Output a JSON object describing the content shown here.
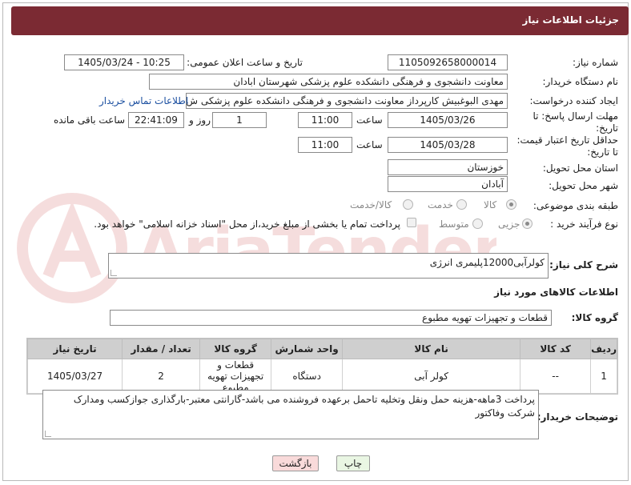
{
  "header": {
    "title": "جزئیات اطلاعات نیاز"
  },
  "form": {
    "need_number_label": "شماره نیاز:",
    "need_number": "1105092658000014",
    "announce_label": "تاریخ و ساعت اعلان عمومی:",
    "announce_value": "1405/03/24 - 10:25",
    "buyer_org_label": "نام دستگاه خریدار:",
    "buyer_org": "معاونت دانشجوی و فرهنگی دانشکده علوم پزشکی شهرستان ابادان",
    "requester_label": "ایجاد کننده درخواست:",
    "requester": "مهدی البوغبیش کارپرداز معاونت دانشجوی و فرهنگی دانشکده علوم پزشکی ش",
    "contact_link": "اطلاعات تماس خریدار",
    "reply_deadline_label": "مهلت ارسال پاسخ: تا تاریخ:",
    "reply_date": "1405/03/26",
    "time_label": "ساعت",
    "reply_time": "11:00",
    "days_value": "1",
    "days_label": "روز و",
    "remaining_time": "22:41:09",
    "remaining_label": "ساعت باقی مانده",
    "price_validity_label": "حداقل تاریخ اعتبار قیمت: تا تاریخ:",
    "validity_date": "1405/03/28",
    "validity_time": "11:00",
    "province_label": "استان محل تحویل:",
    "province": "خوزستان",
    "city_label": "شهر محل تحویل:",
    "city": "آبادان",
    "category_label": "طبقه بندی موضوعی:",
    "category_options": [
      "کالا",
      "خدمت",
      "کالا/خدمت"
    ],
    "process_label": "نوع فرآیند خرید :",
    "process_options": [
      "جزیی",
      "متوسط"
    ],
    "payment_note": "پرداخت تمام یا بخشی از مبلغ خرید،از محل \"اسناد خزانه اسلامی\" خواهد بود."
  },
  "summary": {
    "label": "شرح کلی نیاز:",
    "text": "کولرآبی12000پلیمری انرژی"
  },
  "goods_section": {
    "title": "اطلاعات کالاهای مورد نیاز",
    "group_label": "گروه کالا:",
    "group_value": "قطعات و تجهیزات تهویه مطبوع"
  },
  "table": {
    "headers": [
      "ردیف",
      "کد کالا",
      "نام کالا",
      "واحد شمارش",
      "گروه کالا",
      "تعداد / مقدار",
      "تاریخ نیاز"
    ],
    "rows": [
      [
        "1",
        "--",
        "کولر آبی",
        "دستگاه",
        "قطعات و تجهیزات تهویه مطبوع",
        "2",
        "1405/03/27"
      ]
    ]
  },
  "notes": {
    "label": "توضیحات خریدار:",
    "text": "پرداخت 3ماهه-هزینه حمل ونقل وتخلیه تاحمل برعهده فروشنده می باشد-گارانتی معتبر-بارگذاری جوازکسب ومدارک شرکت وفاکتور"
  },
  "buttons": {
    "print": "چاپ",
    "back": "بازگشت"
  },
  "watermark": {
    "text": "AriaTender.net"
  },
  "colors": {
    "header_bg": "#7b2a33",
    "link": "#1b4fa0",
    "print_bg": "#e9f6e3",
    "back_bg": "#f9dada"
  }
}
